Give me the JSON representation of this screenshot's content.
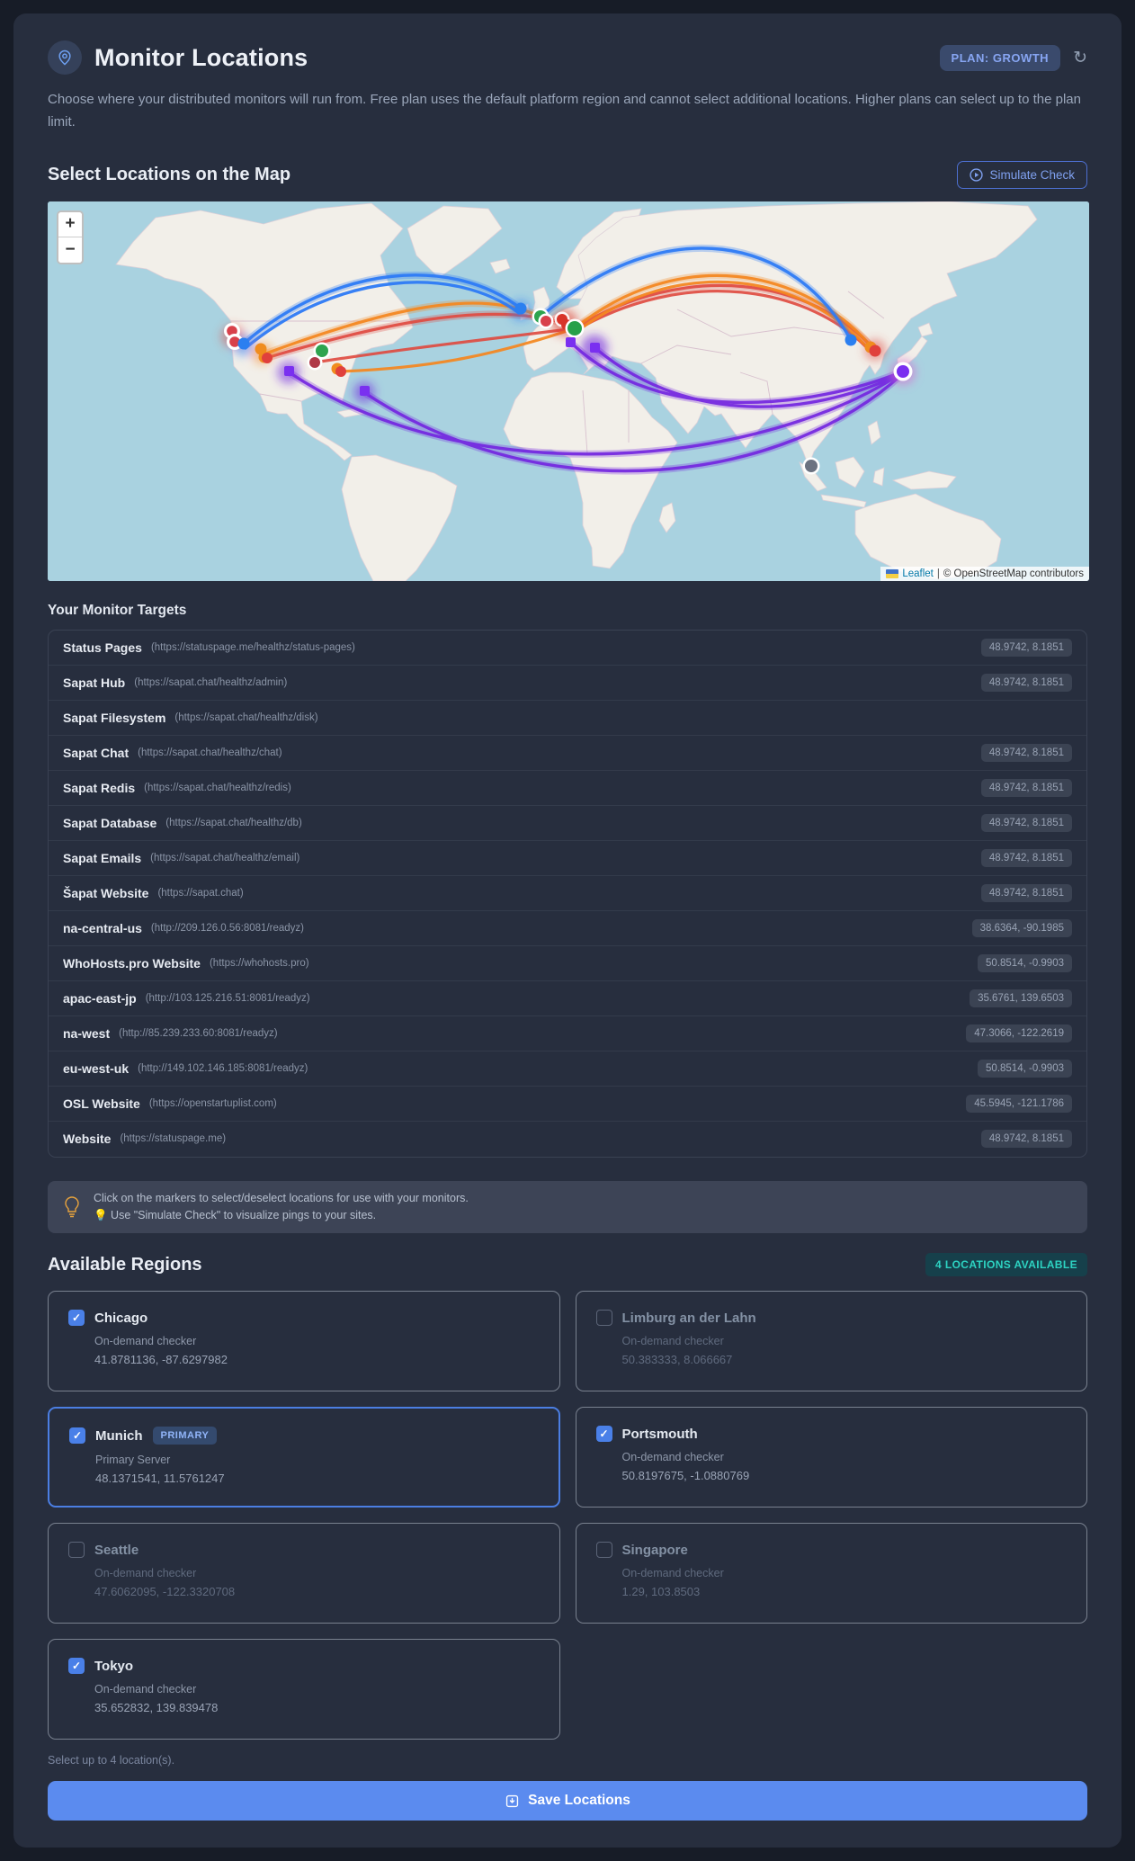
{
  "header": {
    "title": "Monitor Locations",
    "plan_badge": "PLAN: GROWTH",
    "refresh_icon": "↻",
    "description": "Choose where your distributed monitors will run from. Free plan uses the default platform region and cannot select additional locations. Higher plans can select up to the plan limit."
  },
  "map_section": {
    "heading": "Select Locations on the Map",
    "simulate_button": "Simulate Check",
    "zoom_in": "+",
    "zoom_out": "−",
    "attribution": {
      "leaflet": "Leaflet",
      "sep": "|",
      "osm": "© OpenStreetMap contributors"
    }
  },
  "targets_section": {
    "heading": "Your Monitor Targets",
    "items": [
      {
        "name": "Status Pages",
        "url": "(https://statuspage.me/healthz/status-pages)",
        "coords": "48.9742, 8.1851"
      },
      {
        "name": "Sapat Hub",
        "url": "(https://sapat.chat/healthz/admin)",
        "coords": "48.9742, 8.1851"
      },
      {
        "name": "Sapat Filesystem",
        "url": "(https://sapat.chat/healthz/disk)",
        "coords": ""
      },
      {
        "name": "Sapat Chat",
        "url": "(https://sapat.chat/healthz/chat)",
        "coords": "48.9742, 8.1851"
      },
      {
        "name": "Sapat Redis",
        "url": "(https://sapat.chat/healthz/redis)",
        "coords": "48.9742, 8.1851"
      },
      {
        "name": "Sapat Database",
        "url": "(https://sapat.chat/healthz/db)",
        "coords": "48.9742, 8.1851"
      },
      {
        "name": "Sapat Emails",
        "url": "(https://sapat.chat/healthz/email)",
        "coords": "48.9742, 8.1851"
      },
      {
        "name": "Šapat Website",
        "url": "(https://sapat.chat)",
        "coords": "48.9742, 8.1851"
      },
      {
        "name": "na-central-us",
        "url": "(http://209.126.0.56:8081/readyz)",
        "coords": "38.6364, -90.1985"
      },
      {
        "name": "WhoHosts.pro Website",
        "url": "(https://whohosts.pro)",
        "coords": "50.8514, -0.9903"
      },
      {
        "name": "apac-east-jp",
        "url": "(http://103.125.216.51:8081/readyz)",
        "coords": "35.6761, 139.6503"
      },
      {
        "name": "na-west",
        "url": "(http://85.239.233.60:8081/readyz)",
        "coords": "47.3066, -122.2619"
      },
      {
        "name": "eu-west-uk",
        "url": "(http://149.102.146.185:8081/readyz)",
        "coords": "50.8514, -0.9903"
      },
      {
        "name": "OSL Website",
        "url": "(https://openstartuplist.com)",
        "coords": "45.5945, -121.1786"
      },
      {
        "name": "Website",
        "url": "(https://statuspage.me)",
        "coords": "48.9742, 8.1851"
      }
    ]
  },
  "tip": {
    "line1": "Click on the markers to select/deselect locations for use with your monitors.",
    "line2": "💡 Use \"Simulate Check\" to visualize pings to your sites."
  },
  "regions_section": {
    "heading": "Available Regions",
    "badge": "4 LOCATIONS AVAILABLE",
    "regions": [
      {
        "name": "Chicago",
        "desc": "On-demand checker",
        "coords": "41.8781136, -87.6297982",
        "checked": true
      },
      {
        "name": "Limburg an der Lahn",
        "desc": "On-demand checker",
        "coords": "50.383333, 8.066667",
        "checked": false
      },
      {
        "name": "Munich",
        "badge": "PRIMARY",
        "desc": "Primary Server",
        "coords": "48.1371541, 11.5761247",
        "checked": true
      },
      {
        "name": "Portsmouth",
        "desc": "On-demand checker",
        "coords": "50.8197675, -1.0880769",
        "checked": true
      },
      {
        "name": "Seattle",
        "desc": "On-demand checker",
        "coords": "47.6062095, -122.3320708",
        "checked": false
      },
      {
        "name": "Singapore",
        "desc": "On-demand checker",
        "coords": "1.29, 103.8503",
        "checked": false
      },
      {
        "name": "Tokyo",
        "desc": "On-demand checker",
        "coords": "35.652832, 139.839478",
        "checked": true
      }
    ],
    "limit_note": "Select up to 4 location(s)."
  },
  "save_button": "Save Locations",
  "colors": {
    "accent_blue": "#4a80e8",
    "save_button": "#5b8bef",
    "teal_badge_text": "#2dd3c2",
    "plan_badge_text": "#87a5f2",
    "ocean": "#a9d2e0",
    "land": "#f2efe9",
    "arc_blue": "#2e7bf6",
    "arc_orange": "#f5871f",
    "arc_red": "#e0493f",
    "arc_purple": "#7324e0"
  }
}
